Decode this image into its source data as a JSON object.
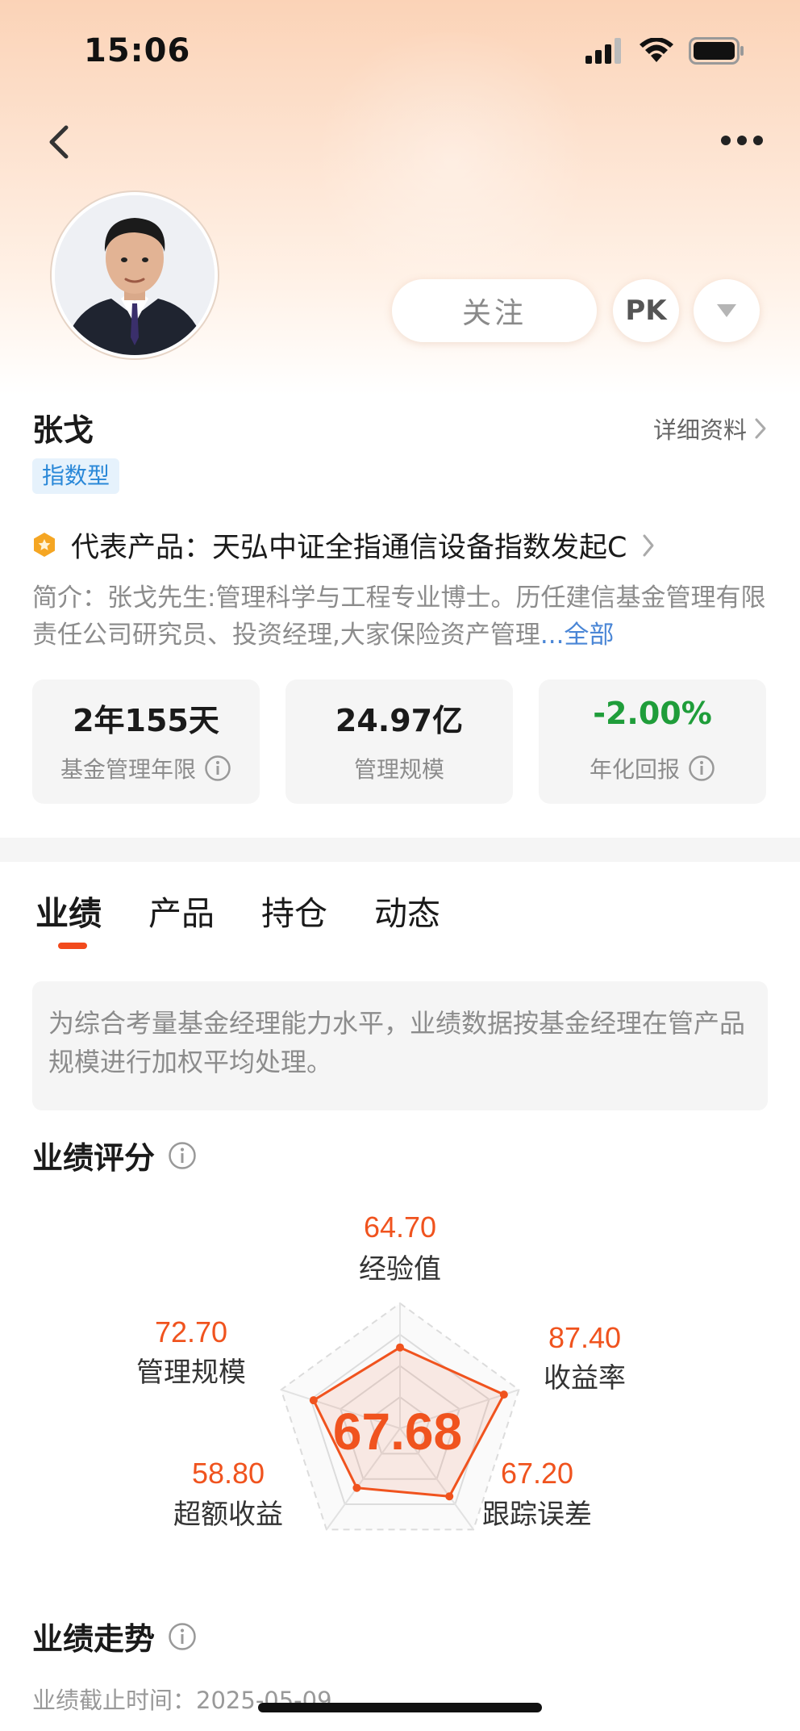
{
  "status_bar": {
    "time": "15:06"
  },
  "header": {
    "follow_label": "关注",
    "pk_label": "PK"
  },
  "manager": {
    "name": "张戈",
    "detail_link": "详细资料",
    "type_tag": "指数型",
    "product_label": "代表产品：",
    "product_name": "天弘中证全指通信设备指数发起C",
    "intro": "简介：张戈先生:管理科学与工程专业博士。历任建信基金管理有限责任公司研究员、投资经理,大家保险资产管理",
    "intro_more": "...全部"
  },
  "stats": [
    {
      "value": "2年155天",
      "label": "基金管理年限",
      "has_info": true,
      "color": "#1a1a1a"
    },
    {
      "value": "24.97亿",
      "label": "管理规模",
      "has_info": false,
      "color": "#1a1a1a"
    },
    {
      "value": "-2.00%",
      "label": "年化回报",
      "has_info": true,
      "color": "#1f9d3a"
    }
  ],
  "tabs": [
    {
      "label": "业绩",
      "active": true
    },
    {
      "label": "产品",
      "active": false
    },
    {
      "label": "持仓",
      "active": false
    },
    {
      "label": "动态",
      "active": false
    }
  ],
  "notice": "为综合考量基金经理能力水平，业绩数据按基金经理在管产品规模进行加权平均处理。",
  "score_section": {
    "title": "业绩评分",
    "total": "67.68",
    "dimensions": [
      {
        "name": "经验值",
        "value": "64.70",
        "score": 64.7
      },
      {
        "name": "收益率",
        "value": "87.40",
        "score": 87.4
      },
      {
        "name": "跟踪误差",
        "value": "67.20",
        "score": 67.2
      },
      {
        "name": "超额收益",
        "value": "58.80",
        "score": 58.8
      },
      {
        "name": "管理规模",
        "value": "72.70",
        "score": 72.7
      }
    ],
    "accent_color": "#f0531e"
  },
  "trend_section": {
    "title": "业绩走势",
    "date_label": "业绩截止时间：",
    "date_value": "2025-05-09"
  }
}
